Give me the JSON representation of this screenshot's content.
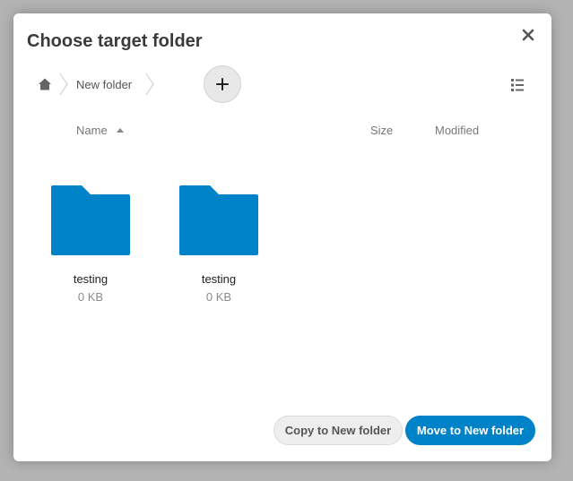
{
  "dialog": {
    "title": "Choose target folder",
    "close_icon": "close-icon"
  },
  "breadcrumb": {
    "home_icon": "home-icon",
    "items": [
      {
        "label": "New folder"
      }
    ]
  },
  "toolbar": {
    "add_icon": "plus-icon",
    "view_toggle_icon": "list-view-icon"
  },
  "table": {
    "columns": {
      "name": "Name",
      "size": "Size",
      "modified": "Modified"
    },
    "sort_icon": "sort-ascending-icon"
  },
  "files": [
    {
      "name": "testing",
      "size": "0 KB",
      "icon": "folder-icon"
    },
    {
      "name": "testing",
      "size": "0 KB",
      "icon": "folder-icon"
    }
  ],
  "actions": {
    "copy_label": "Copy to New folder",
    "move_label": "Move to New folder"
  },
  "colors": {
    "primary": "#0082c9",
    "folder": "#0082c9",
    "overlay": "#b3b3b3"
  }
}
